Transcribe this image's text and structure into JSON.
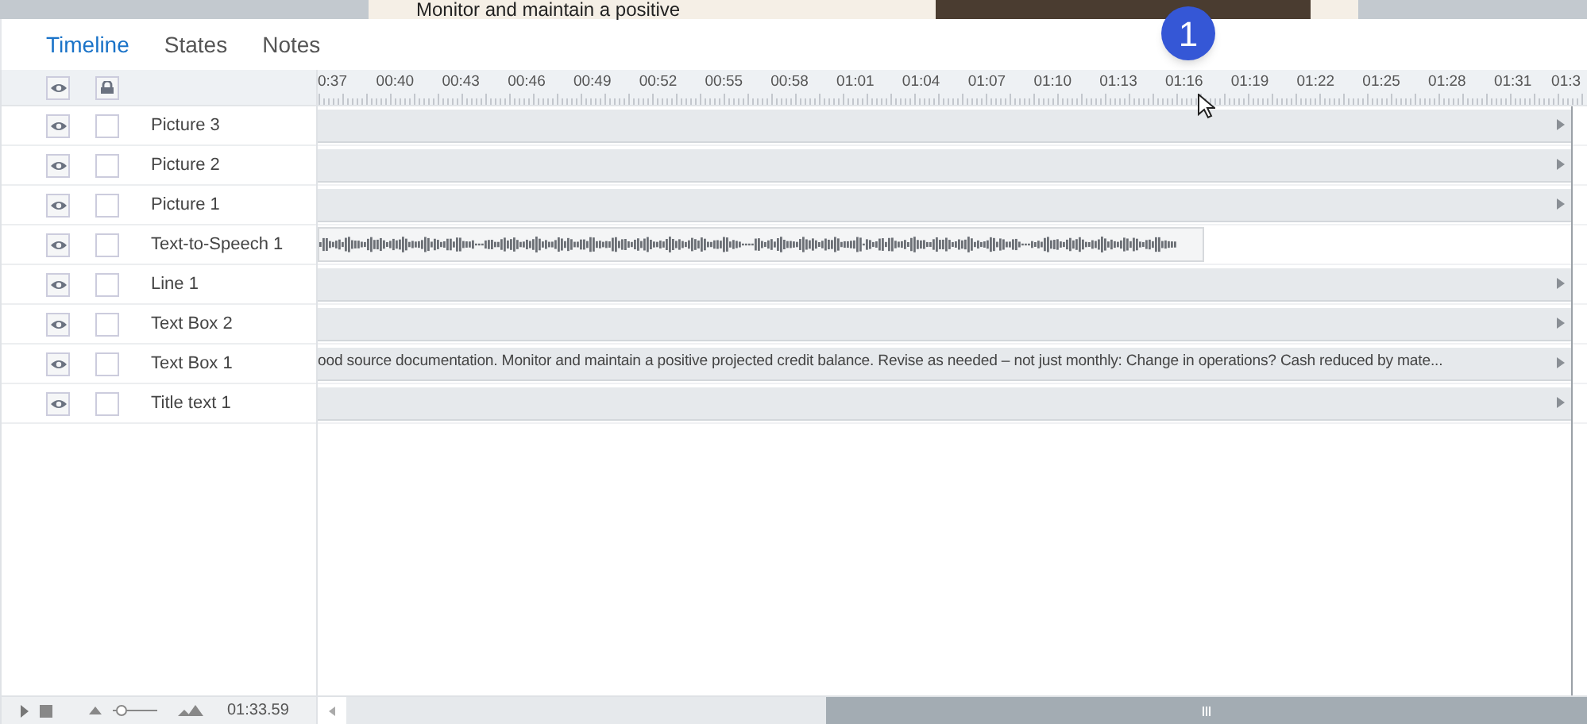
{
  "slide_preview": {
    "text": "Monitor and maintain a positive"
  },
  "tabs": [
    {
      "label": "Timeline",
      "selected": true
    },
    {
      "label": "States",
      "selected": false
    },
    {
      "label": "Notes",
      "selected": false
    }
  ],
  "marker": {
    "label": "1"
  },
  "ruler": {
    "ticks": [
      "0:37",
      "00:40",
      "00:43",
      "00:46",
      "00:49",
      "00:52",
      "00:55",
      "00:58",
      "01:01",
      "01:04",
      "01:07",
      "01:10",
      "01:13",
      "01:16",
      "01:19",
      "01:22",
      "01:25",
      "01:28",
      "01:31",
      "01:3"
    ]
  },
  "layers": [
    {
      "name": "Picture 3",
      "visible": true,
      "locked": false,
      "kind": "bar"
    },
    {
      "name": "Picture 2",
      "visible": true,
      "locked": false,
      "kind": "bar"
    },
    {
      "name": "Picture 1",
      "visible": true,
      "locked": false,
      "kind": "bar"
    },
    {
      "name": "Text-to-Speech 1",
      "visible": true,
      "locked": false,
      "kind": "audio"
    },
    {
      "name": "Line 1",
      "visible": true,
      "locked": false,
      "kind": "bar"
    },
    {
      "name": "Text Box 2",
      "visible": true,
      "locked": false,
      "kind": "bar"
    },
    {
      "name": "Text Box 1",
      "visible": true,
      "locked": false,
      "kind": "bar",
      "text": "ood source documentation. Monitor and maintain a positive projected credit balance. Revise as needed – not just monthly: Change in operations? Cash reduced by mate..."
    },
    {
      "name": "Title text 1",
      "visible": true,
      "locked": false,
      "kind": "bar"
    }
  ],
  "footer": {
    "zoom": {
      "level": 0.1
    },
    "time": "01:33.59"
  }
}
